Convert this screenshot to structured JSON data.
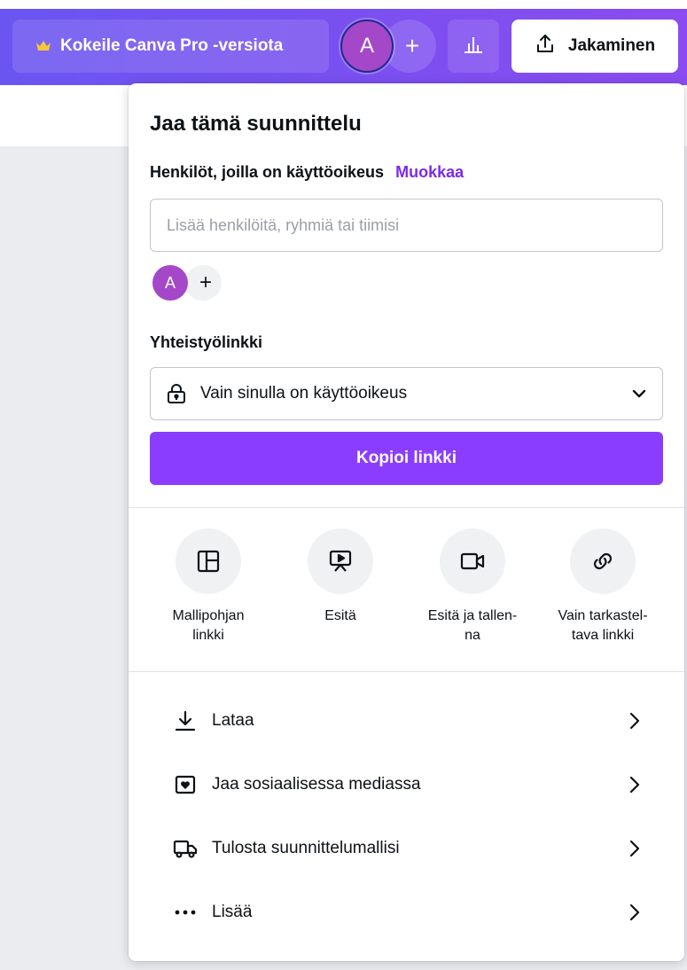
{
  "topbar": {
    "pro_label": "Kokeile Canva Pro -versiota",
    "avatar_initial": "A",
    "add_label": "+",
    "share_label": "Jakaminen"
  },
  "panel": {
    "title": "Jaa tämä suunnittelu",
    "access_label": "Henkilöt, joilla on käyttöoikeus",
    "edit_label": "Muokkaa",
    "input_placeholder": "Lisää henkilöitä, ryhmiä tai tiimisi",
    "member_initial": "A",
    "add_member": "+",
    "collab_title": "Yhteistyölinkki",
    "collab_value": "Vain sinulla on käyttöoikeus",
    "copy_label": "Kopioi linkki"
  },
  "options": [
    {
      "label": "Mallipohjan linkki",
      "icon": "template-icon"
    },
    {
      "label": "Esitä",
      "icon": "present-icon"
    },
    {
      "label": "Esitä ja tallen-na",
      "icon": "record-icon"
    },
    {
      "label": "Vain tarkastel-tava linkki",
      "icon": "link-icon"
    }
  ],
  "menu": [
    {
      "label": "Lataa",
      "icon": "download-icon"
    },
    {
      "label": "Jaa sosiaalisessa mediassa",
      "icon": "social-heart-icon"
    },
    {
      "label": "Tulosta suunnittelumallisi",
      "icon": "truck-icon"
    },
    {
      "label": "Lisää",
      "icon": "more-dots-icon"
    }
  ],
  "colors": {
    "accent": "#8b3dff",
    "link": "#7d2ae8",
    "avatar": "#a447c9"
  }
}
